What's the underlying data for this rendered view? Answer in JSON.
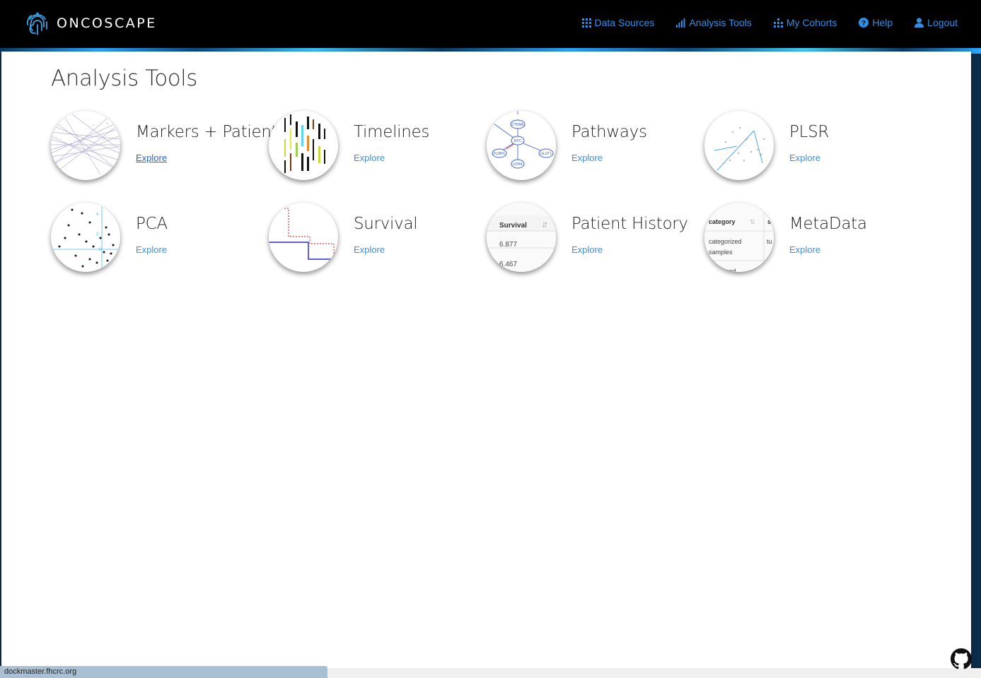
{
  "brand": {
    "name": "ONCOSCAPE",
    "logo_icon": "fingerprint-icon"
  },
  "nav": [
    {
      "label": "Data Sources",
      "icon": "grid-icon"
    },
    {
      "label": "Analysis Tools",
      "icon": "bar-chart-icon"
    },
    {
      "label": "My Cohorts",
      "icon": "cohort-icon"
    },
    {
      "label": "Help",
      "icon": "question-circle-icon"
    },
    {
      "label": "Logout",
      "icon": "user-icon"
    }
  ],
  "page": {
    "title": "Analysis Tools"
  },
  "tools": [
    {
      "name": "Markers + Patients",
      "link": "Explore"
    },
    {
      "name": "Timelines",
      "link": "Explore"
    },
    {
      "name": "Pathways",
      "link": "Explore"
    },
    {
      "name": "PLSR",
      "link": "Explore"
    },
    {
      "name": "PCA",
      "link": "Explore"
    },
    {
      "name": "Survival",
      "link": "Explore"
    },
    {
      "name": "Patient History",
      "link": "Explore"
    },
    {
      "name": "MetaData",
      "link": "Explore"
    }
  ],
  "thumb_text": {
    "pathways": [
      "CTNNB",
      "MYC",
      "FUBP1",
      "GLUT1",
      "LDHA"
    ],
    "pca_ticks": [
      "4",
      "2",
      "0"
    ],
    "history": {
      "header": "Survival",
      "row1": "6.877",
      "row2": "6.467"
    },
    "metadata": {
      "header": "category",
      "header2": "s",
      "cell1": "categorized",
      "cell2": "samples",
      "cell3": "tu",
      "cell4": "orized"
    }
  },
  "status_url": "dockmaster.fhcrc.org",
  "colors": {
    "nav_link": "#2f8fe6",
    "link": "#3a8ee0",
    "navbar_bg": "#000000"
  }
}
